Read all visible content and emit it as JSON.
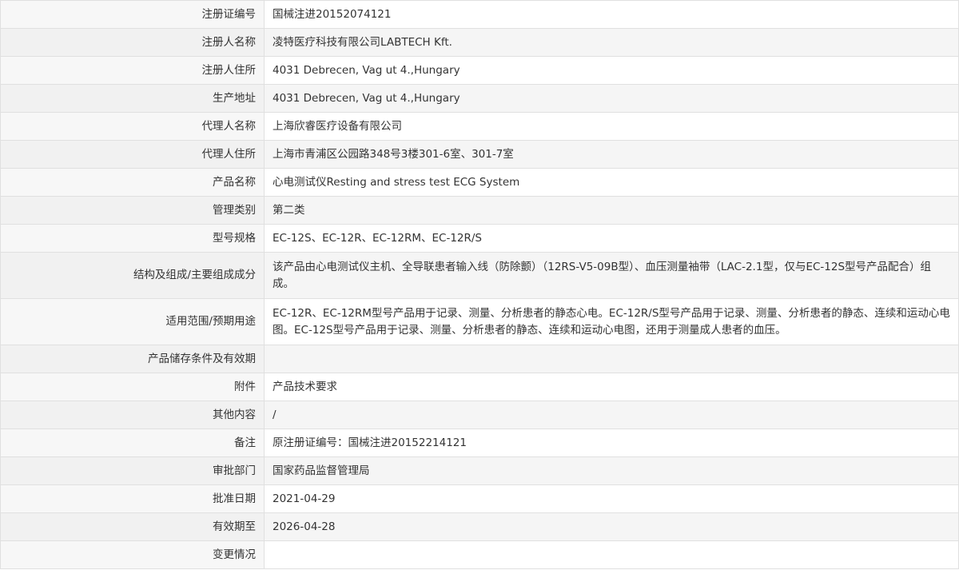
{
  "rows": [
    {
      "label": "注册证编号",
      "value": "国械注进20152074121"
    },
    {
      "label": "注册人名称",
      "value": "凌特医疗科技有限公司LABTECH Kft."
    },
    {
      "label": "注册人住所",
      "value": "4031 Debrecen, Vag ut 4.,Hungary"
    },
    {
      "label": "生产地址",
      "value": "4031 Debrecen, Vag ut 4.,Hungary"
    },
    {
      "label": "代理人名称",
      "value": "上海欣睿医疗设备有限公司"
    },
    {
      "label": "代理人住所",
      "value": "上海市青浦区公园路348号3楼301-6室、301-7室"
    },
    {
      "label": "产品名称",
      "value": "心电测试仪Resting and stress test ECG System"
    },
    {
      "label": "管理类别",
      "value": "第二类"
    },
    {
      "label": "型号规格",
      "value": "EC-12S、EC-12R、EC-12RM、EC-12R/S"
    },
    {
      "label": "结构及组成/主要组成成分",
      "value": "该产品由心电测试仪主机、全导联患者输入线（防除颤）（12RS-V5-09B型）、血压测量袖带（LAC-2.1型，仅与EC-12S型号产品配合）组成。"
    },
    {
      "label": "适用范围/预期用途",
      "value": "EC-12R、EC-12RM型号产品用于记录、测量、分析患者的静态心电。EC-12R/S型号产品用于记录、测量、分析患者的静态、连续和运动心电图。EC-12S型号产品用于记录、测量、分析患者的静态、连续和运动心电图，还用于测量成人患者的血压。"
    },
    {
      "label": "产品储存条件及有效期",
      "value": ""
    },
    {
      "label": "附件",
      "value": "产品技术要求"
    },
    {
      "label": "其他内容",
      "value": "/"
    },
    {
      "label": "备注",
      "value": "原注册证编号：国械注进20152214121"
    },
    {
      "label": "审批部门",
      "value": "国家药品监督管理局"
    },
    {
      "label": "批准日期",
      "value": "2021-04-29"
    },
    {
      "label": "有效期至",
      "value": "2026-04-28"
    },
    {
      "label": "变更情况",
      "value": ""
    }
  ]
}
